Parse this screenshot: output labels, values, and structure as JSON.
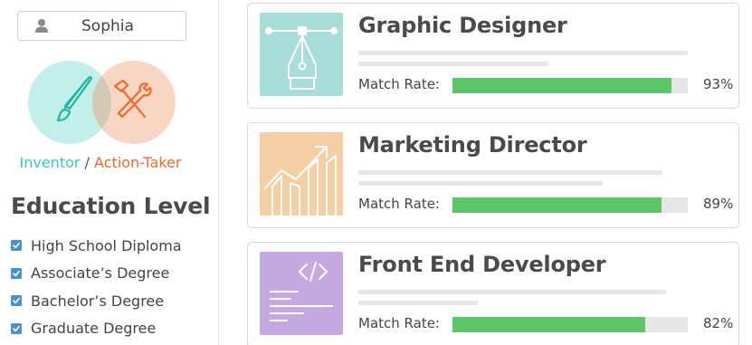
{
  "user": {
    "name": "Sophia",
    "icon": "person-icon"
  },
  "persona": {
    "primary": "Inventor",
    "separator": " / ",
    "secondary": "Action-Taker",
    "primary_color": "#35c9b5",
    "secondary_color": "#ee6b2d",
    "primary_icon": "paintbrush-icon",
    "secondary_icon": "hammer-wrench-icon"
  },
  "education": {
    "title": "Education Level",
    "items": [
      {
        "label": "High School Diploma",
        "checked": true
      },
      {
        "label": "Associate’s Degree",
        "checked": true
      },
      {
        "label": "Bachelor’s Degree",
        "checked": true
      },
      {
        "label": "Graduate Degree",
        "checked": true
      }
    ]
  },
  "jobs": [
    {
      "title": "Graphic Designer",
      "match_label": "Match Rate:",
      "match": 93,
      "match_text": "93%",
      "icon": "pen-tool-icon",
      "color": "#a9ddd8"
    },
    {
      "title": "Marketing Director",
      "match_label": "Match Rate:",
      "match": 89,
      "match_text": "89%",
      "icon": "growth-chart-icon",
      "color": "#f3cfa3"
    },
    {
      "title": "Front End Developer",
      "match_label": "Match Rate:",
      "match": 82,
      "match_text": "82%",
      "icon": "code-icon",
      "color": "#c7a9e2"
    }
  ],
  "colors": {
    "bar_fill": "#5cc668",
    "bar_track": "#e6e6e6",
    "checkbox": "#4a90c9"
  }
}
